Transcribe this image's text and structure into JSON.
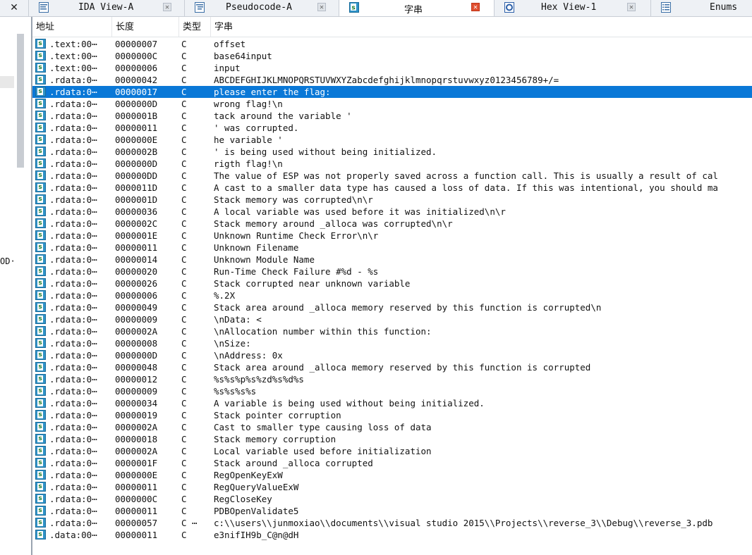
{
  "tabs": [
    {
      "label": "IDA View-A",
      "icon": "ida-view-icon"
    },
    {
      "label": "Pseudocode-A",
      "icon": "pseudocode-icon"
    },
    {
      "label": "字串",
      "icon": "strings-icon",
      "active": true
    },
    {
      "label": "Hex View-1",
      "icon": "hex-view-icon"
    },
    {
      "label": "Enums",
      "icon": "enums-icon"
    }
  ],
  "left_close_glyph": "✕",
  "left_pane_fragment": "OD·",
  "columns": {
    "addr": "地址",
    "len": "长度",
    "type": "类型",
    "str": "字串"
  },
  "rows": [
    {
      "addr": ".text:00⋯",
      "len": "00000007",
      "type": "C",
      "str": "offset"
    },
    {
      "addr": ".text:00⋯",
      "len": "0000000C",
      "type": "C",
      "str": "base64input"
    },
    {
      "addr": ".text:00⋯",
      "len": "00000006",
      "type": "C",
      "str": "input"
    },
    {
      "addr": ".rdata:0⋯",
      "len": "00000042",
      "type": "C",
      "str": "ABCDEFGHIJKLMNOPQRSTUVWXYZabcdefghijklmnopqrstuvwxyz0123456789+/="
    },
    {
      "addr": ".rdata:0⋯",
      "len": "00000017",
      "type": "C",
      "str": "please enter the flag:",
      "selected": true
    },
    {
      "addr": ".rdata:0⋯",
      "len": "0000000D",
      "type": "C",
      "str": "wrong flag!\\n"
    },
    {
      "addr": ".rdata:0⋯",
      "len": "0000001B",
      "type": "C",
      "str": "tack around the variable '"
    },
    {
      "addr": ".rdata:0⋯",
      "len": "00000011",
      "type": "C",
      "str": "' was corrupted."
    },
    {
      "addr": ".rdata:0⋯",
      "len": "0000000E",
      "type": "C",
      "str": "he variable '"
    },
    {
      "addr": ".rdata:0⋯",
      "len": "0000002B",
      "type": "C",
      "str": "' is being used without being initialized."
    },
    {
      "addr": ".rdata:0⋯",
      "len": "0000000D",
      "type": "C",
      "str": "rigth flag!\\n"
    },
    {
      "addr": ".rdata:0⋯",
      "len": "000000DD",
      "type": "C",
      "str": "The value of ESP was not properly saved across a function call.  This is usually a result of cal"
    },
    {
      "addr": ".rdata:0⋯",
      "len": "0000011D",
      "type": "C",
      "str": "A cast to a smaller data type has caused a loss of data.  If this was intentional, you should ma"
    },
    {
      "addr": ".rdata:0⋯",
      "len": "0000001D",
      "type": "C",
      "str": "Stack memory was corrupted\\n\\r"
    },
    {
      "addr": ".rdata:0⋯",
      "len": "00000036",
      "type": "C",
      "str": "A local variable was used before it was initialized\\n\\r"
    },
    {
      "addr": ".rdata:0⋯",
      "len": "0000002C",
      "type": "C",
      "str": "Stack memory around _alloca was corrupted\\n\\r"
    },
    {
      "addr": ".rdata:0⋯",
      "len": "0000001E",
      "type": "C",
      "str": "Unknown Runtime Check Error\\n\\r"
    },
    {
      "addr": ".rdata:0⋯",
      "len": "00000011",
      "type": "C",
      "str": "Unknown Filename"
    },
    {
      "addr": ".rdata:0⋯",
      "len": "00000014",
      "type": "C",
      "str": "Unknown Module Name"
    },
    {
      "addr": ".rdata:0⋯",
      "len": "00000020",
      "type": "C",
      "str": "Run-Time Check Failure #%d - %s"
    },
    {
      "addr": ".rdata:0⋯",
      "len": "00000026",
      "type": "C",
      "str": "Stack corrupted near unknown variable"
    },
    {
      "addr": ".rdata:0⋯",
      "len": "00000006",
      "type": "C",
      "str": "%.2X"
    },
    {
      "addr": ".rdata:0⋯",
      "len": "00000049",
      "type": "C",
      "str": "Stack area around _alloca memory reserved by this function is corrupted\\n"
    },
    {
      "addr": ".rdata:0⋯",
      "len": "00000009",
      "type": "C",
      "str": "\\nData: <"
    },
    {
      "addr": ".rdata:0⋯",
      "len": "0000002A",
      "type": "C",
      "str": "\\nAllocation number within this function:"
    },
    {
      "addr": ".rdata:0⋯",
      "len": "00000008",
      "type": "C",
      "str": "\\nSize:"
    },
    {
      "addr": ".rdata:0⋯",
      "len": "0000000D",
      "type": "C",
      "str": "\\nAddress: 0x"
    },
    {
      "addr": ".rdata:0⋯",
      "len": "00000048",
      "type": "C",
      "str": "Stack area around _alloca memory reserved by this function is corrupted"
    },
    {
      "addr": ".rdata:0⋯",
      "len": "00000012",
      "type": "C",
      "str": "%s%s%p%s%zd%s%d%s"
    },
    {
      "addr": ".rdata:0⋯",
      "len": "00000009",
      "type": "C",
      "str": "%s%s%s%s"
    },
    {
      "addr": ".rdata:0⋯",
      "len": "00000034",
      "type": "C",
      "str": "A variable is being used without being initialized."
    },
    {
      "addr": ".rdata:0⋯",
      "len": "00000019",
      "type": "C",
      "str": "Stack pointer corruption"
    },
    {
      "addr": ".rdata:0⋯",
      "len": "0000002A",
      "type": "C",
      "str": "Cast to smaller type causing loss of data"
    },
    {
      "addr": ".rdata:0⋯",
      "len": "00000018",
      "type": "C",
      "str": "Stack memory corruption"
    },
    {
      "addr": ".rdata:0⋯",
      "len": "0000002A",
      "type": "C",
      "str": "Local variable used before initialization"
    },
    {
      "addr": ".rdata:0⋯",
      "len": "0000001F",
      "type": "C",
      "str": "Stack around _alloca corrupted"
    },
    {
      "addr": ".rdata:0⋯",
      "len": "0000000E",
      "type": "C",
      "str": "RegOpenKeyExW"
    },
    {
      "addr": ".rdata:0⋯",
      "len": "00000011",
      "type": "C",
      "str": "RegQueryValueExW"
    },
    {
      "addr": ".rdata:0⋯",
      "len": "0000000C",
      "type": "C",
      "str": "RegCloseKey"
    },
    {
      "addr": ".rdata:0⋯",
      "len": "00000011",
      "type": "C",
      "str": "PDBOpenValidate5"
    },
    {
      "addr": ".rdata:0⋯",
      "len": "00000057",
      "type": "C ⋯",
      "str": "c:\\\\users\\\\junmoxiao\\\\documents\\\\visual studio 2015\\\\Projects\\\\reverse_3\\\\Debug\\\\reverse_3.pdb"
    },
    {
      "addr": ".data:00⋯",
      "len": "00000011",
      "type": "C",
      "str": "e3nifIH9b_C@n@dH"
    }
  ],
  "colors": {
    "selection": "#0a78d7",
    "active_tab_close": "#e05030",
    "string_icon": "#2f93c8"
  }
}
